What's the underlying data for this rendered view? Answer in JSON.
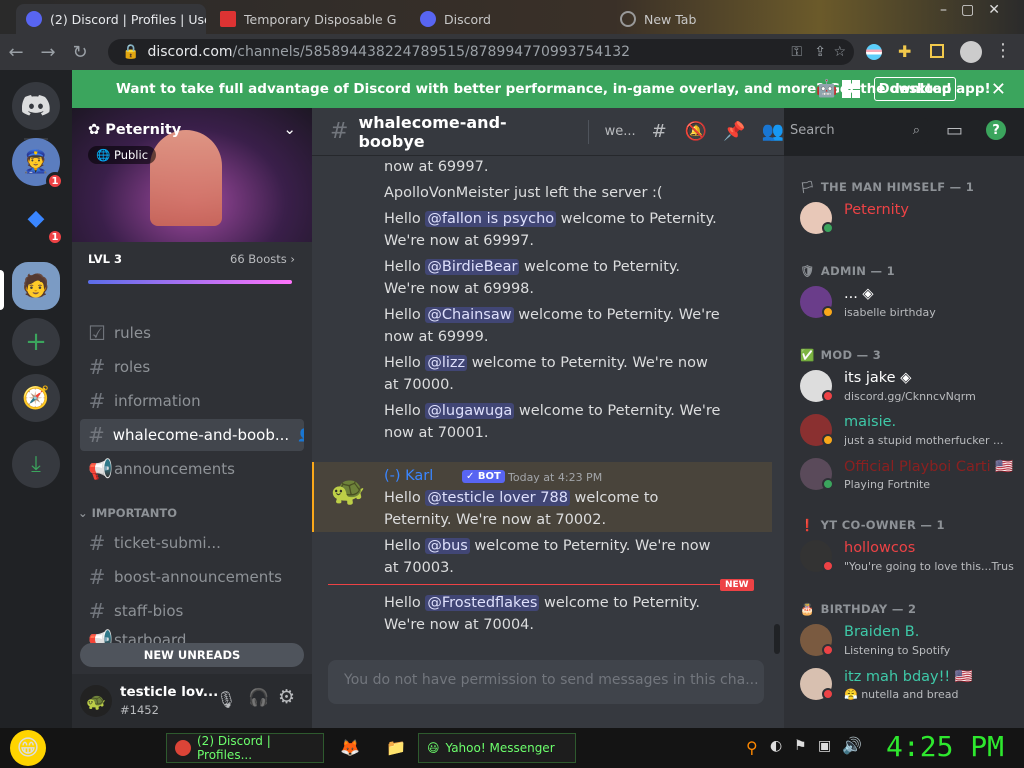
{
  "browser": {
    "tabs": [
      {
        "title": "(2) Discord | Profiles | Use",
        "active": true
      },
      {
        "title": "Temporary Disposable G",
        "active": false
      },
      {
        "title": "Discord",
        "active": false
      },
      {
        "title": "New Tab",
        "active": false
      }
    ],
    "url_host": "discord.com",
    "url_path": "/channels/585894438224789515/878994770993754132"
  },
  "banner": {
    "text": "Want to take full advantage of Discord with better performance, in-game overlay, and more? Get the desktop app!",
    "download": "Download"
  },
  "guilds": [
    {
      "icon": "discord-home"
    },
    {
      "badge": "1"
    },
    {
      "badge": "1"
    },
    {
      "icon": "active"
    },
    {
      "icon": "add-server"
    },
    {
      "icon": "explore"
    },
    {
      "icon": "download"
    }
  ],
  "server": {
    "name": "Peternity",
    "visibility": "Public",
    "level": "LVL 3",
    "boosts": "66 Boosts",
    "channels": [
      "rules",
      "roles",
      "information",
      "whalecome-and-boob...",
      "announcements"
    ],
    "category": "IMPORTANTO",
    "channels2": [
      "ticket-submi...",
      "boost-announcements",
      "staff-bios",
      "starboard"
    ],
    "new_unreads": "NEW UNREADS"
  },
  "user": {
    "name": "testicle lov...",
    "tag": "#1452"
  },
  "chat": {
    "channel": "whalecome-and-boobye",
    "topic": "we...",
    "search": "Search",
    "lines_top": [
      {
        "pre": "now at 69997.",
        "mention": "",
        "post": ""
      },
      {
        "pre": "ApolloVonMeister just left the server :(",
        "mention": "",
        "post": ""
      },
      {
        "pre": "Hello ",
        "mention": "@fallon is psycho",
        "post": " welcome to Peternity. We're now at 69997."
      },
      {
        "pre": "Hello ",
        "mention": "@BirdieBear",
        "post": " welcome to Peternity. We're now at 69998."
      },
      {
        "pre": "Hello ",
        "mention": "@Chainsaw",
        "post": " welcome to Peternity. We're now at 69999."
      },
      {
        "pre": "Hello ",
        "mention": "@lizz",
        "post": " welcome to Peternity. We're now at 70000."
      },
      {
        "pre": "Hello ",
        "mention": "@lugawuga",
        "post": " welcome to Peternity. We're now at 70001."
      }
    ],
    "author": "(-) Karl",
    "bot": "✓ BOT",
    "timestamp": "Today at 4:23 PM",
    "lines_bottom": [
      {
        "pre": "Hello ",
        "mention": "@testicle lover 788",
        "post": " welcome to Peternity. We're now at 70002."
      },
      {
        "pre": "Hello ",
        "mention": "@bus",
        "post": " welcome to Peternity. We're now at 70003."
      },
      {
        "pre": "Hello ",
        "mention": "@Frostedflakes",
        "post": " welcome to Peternity. We're now at 70004."
      }
    ],
    "new_label": "NEW",
    "input_placeholder": "You do not have permission to send messages in this cha..."
  },
  "members": {
    "roles": [
      {
        "label": "THE MAN HIMSELF — 1",
        "icon": "🏳"
      },
      {
        "label": "ADMIN — 1",
        "icon": "🛡"
      },
      {
        "label": "MOD — 3",
        "icon": "✅"
      },
      {
        "label": "YT CO-OWNER — 1",
        "icon": "❗"
      },
      {
        "label": "BIRTHDAY — 2",
        "icon": "🎂"
      }
    ],
    "list": [
      {
        "name": "Peternity",
        "sub": "",
        "color": "#ed4245",
        "status": "#3ba55d"
      },
      {
        "name": "... ◈",
        "sub": "isabelle birthday",
        "color": "#ffffff",
        "status": "#faa81a"
      },
      {
        "name": "its jake ◈",
        "sub": "discord.gg/CknncvNqrm",
        "color": "#ffffff",
        "status": "#ed4245"
      },
      {
        "name": "maisie.",
        "sub": "just a stupid motherfucker ...",
        "color": "#3ec9a8",
        "status": "#faa81a"
      },
      {
        "name": "Official Playboi Carti 🇺🇸",
        "sub": "Playing Fortnite",
        "color": "#8a2020",
        "status": "#3ba55d"
      },
      {
        "name": "hollowcos",
        "sub": "\"You're going to love this...Trus...",
        "color": "#ed4245",
        "status": "#ed4245"
      },
      {
        "name": "Braiden B.",
        "sub": "Listening to Spotify",
        "color": "#3ec9a8",
        "status": "#ed4245"
      },
      {
        "name": "itz mah bday!! 🇺🇸",
        "sub": "😤 nutella and bread",
        "color": "#3ec9a8",
        "status": "#ed4245"
      }
    ]
  },
  "taskbar": {
    "task1": "(2) Discord | Profiles...",
    "task2": "Yahoo! Messenger",
    "clock": "4:25 PM"
  }
}
